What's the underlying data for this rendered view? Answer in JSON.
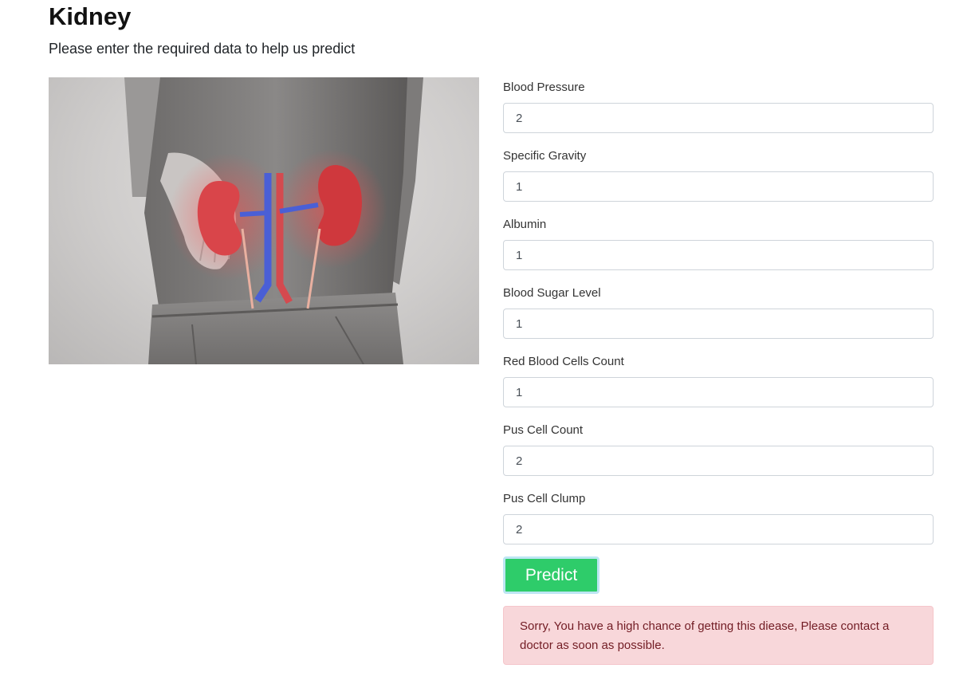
{
  "header": {
    "title": "Kidney",
    "subtitle": "Please enter the required data to help us predict"
  },
  "form": {
    "fields": [
      {
        "label": "Blood Pressure",
        "value": "2"
      },
      {
        "label": "Specific Gravity",
        "value": "1"
      },
      {
        "label": "Albumin",
        "value": "1"
      },
      {
        "label": "Blood Sugar Level",
        "value": "1"
      },
      {
        "label": "Red Blood Cells Count",
        "value": "1"
      },
      {
        "label": "Pus Cell Count",
        "value": "2"
      },
      {
        "label": "Pus Cell Clump",
        "value": "2"
      }
    ],
    "submit_label": "Predict"
  },
  "result": {
    "message": "Sorry, You have a high chance of getting this diease, Please contact a doctor as soon as possible."
  },
  "colors": {
    "button": "#2ecc6a",
    "alert_background": "#f8d7da",
    "alert_text": "#721c24"
  }
}
